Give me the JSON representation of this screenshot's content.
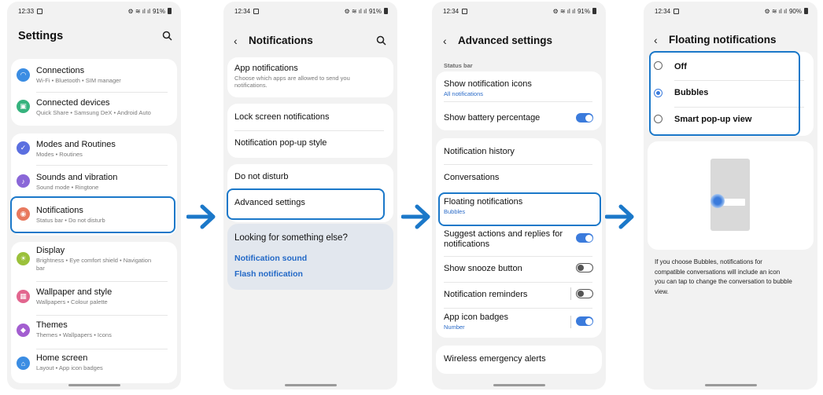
{
  "screens": [
    {
      "time": "12:33",
      "battery": "91%",
      "title": "Settings",
      "items": [
        {
          "label": "Connections",
          "sub": "Wi-Fi • Bluetooth • SIM manager",
          "icon": "wifi-icon",
          "color": "#3b8de3"
        },
        {
          "label": "Connected devices",
          "sub": "Quick Share • Samsung DeX • Android Auto",
          "icon": "devices-icon",
          "color": "#36b37e"
        },
        {
          "label": "Modes and Routines",
          "sub": "Modes • Routines",
          "icon": "check-circle-icon",
          "color": "#5b6fe0"
        },
        {
          "label": "Sounds and vibration",
          "sub": "Sound mode • Ringtone",
          "icon": "speaker-icon",
          "color": "#8a67d8"
        },
        {
          "label": "Notifications",
          "sub": "Status bar • Do not disturb",
          "icon": "bell-icon",
          "color": "#e8795e"
        },
        {
          "label": "Display",
          "sub": "Brightness • Eye comfort shield • Navigation",
          "sub2": "bar",
          "icon": "sun-icon",
          "color": "#9bc13b"
        },
        {
          "label": "Wallpaper and style",
          "sub": "Wallpapers • Colour palette",
          "icon": "picture-icon",
          "color": "#e2668f"
        },
        {
          "label": "Themes",
          "sub": "Themes • Wallpapers • Icons",
          "icon": "palette-icon",
          "color": "#a35ed0"
        },
        {
          "label": "Home screen",
          "sub": "Layout • App icon badges",
          "icon": "home-icon",
          "color": "#3b8de3"
        }
      ]
    },
    {
      "time": "12:34",
      "battery": "91%",
      "title": "Notifications",
      "app_notifications": {
        "label": "App notifications",
        "sub": "Choose which apps are allowed to send you",
        "sub2": "notifications."
      },
      "items": [
        "Lock screen notifications",
        "Notification pop-up style",
        "Do not disturb",
        "Advanced settings"
      ],
      "suggest": {
        "title": "Looking for something else?",
        "links": [
          "Notification sound",
          "Flash notification"
        ]
      }
    },
    {
      "time": "12:34",
      "battery": "91%",
      "title": "Advanced settings",
      "section": "Status bar",
      "show_icons": {
        "label": "Show notification icons",
        "sub": "All notifications"
      },
      "battery_pct": {
        "label": "Show battery percentage",
        "on": true
      },
      "history": "Notification history",
      "conversations": "Conversations",
      "floating": {
        "label": "Floating notifications",
        "sub": "Bubbles"
      },
      "suggest_actions": {
        "label": "Suggest actions and replies for",
        "label2": "notifications",
        "on": true
      },
      "snooze": {
        "label": "Show snooze button",
        "on": false
      },
      "reminders": {
        "label": "Notification reminders",
        "on": false
      },
      "badges": {
        "label": "App icon badges",
        "sub": "Number",
        "on": true
      },
      "wireless": "Wireless emergency alerts"
    },
    {
      "time": "12:34",
      "battery": "90%",
      "title": "Floating notifications",
      "options": [
        {
          "label": "Off",
          "selected": false
        },
        {
          "label": "Bubbles",
          "selected": true
        },
        {
          "label": "Smart pop-up view",
          "selected": false
        }
      ],
      "description": [
        "If you choose Bubbles, notifications for",
        "compatible conversations will include an icon",
        "you can tap to change the conversation to bubble",
        "view."
      ]
    }
  ],
  "colors": {
    "accent": "#1b78c9",
    "toggle_on": "#3b7bdc",
    "link": "#2369c7"
  }
}
